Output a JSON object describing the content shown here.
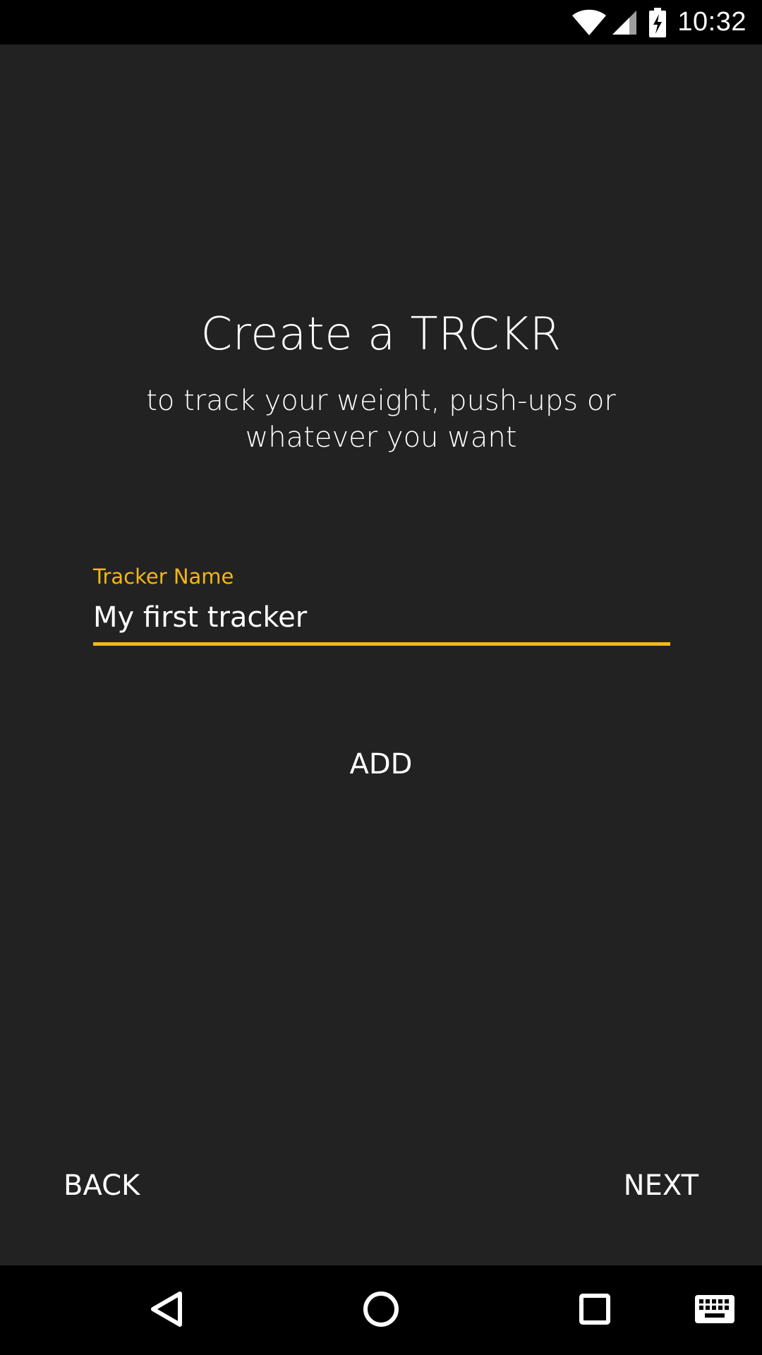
{
  "status_bar": {
    "time": "10:32",
    "icons": [
      "wifi-icon",
      "cellular-signal-icon",
      "battery-charging-icon"
    ]
  },
  "main": {
    "title": "Create a TRCKR",
    "subtitle": "to track your weight, push-ups or whatever you want",
    "tracker_field": {
      "label": "Tracker Name",
      "value": "My first tracker"
    },
    "add_label": "ADD"
  },
  "footer": {
    "back_label": "BACK",
    "next_label": "NEXT"
  },
  "navigation_bar": {
    "icons": [
      "back-triangle-icon",
      "home-circle-icon",
      "recents-square-icon",
      "keyboard-icon"
    ]
  },
  "colors": {
    "background": "#222222",
    "accent": "#f5b61a",
    "text": "#ffffff",
    "bars": "#000000"
  }
}
